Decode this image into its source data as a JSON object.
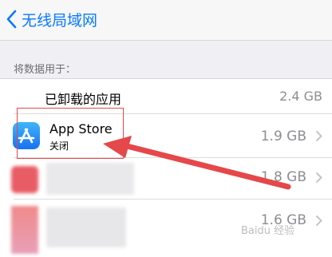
{
  "nav": {
    "back_label": "无线局域网"
  },
  "section": {
    "header": "将数据用于："
  },
  "rows": [
    {
      "title": "已卸载的应用",
      "value": "2.4 GB"
    },
    {
      "title": "App Store",
      "subtitle": "关闭",
      "value": "1.9 GB"
    },
    {
      "title": "",
      "value": "1.8 GB"
    },
    {
      "title": "",
      "value": "1.6 GB"
    }
  ],
  "colors": {
    "accent": "#0a7aff",
    "annotation": "#e5484a",
    "background": "#efeff4"
  },
  "watermark": "Baidu 经验"
}
